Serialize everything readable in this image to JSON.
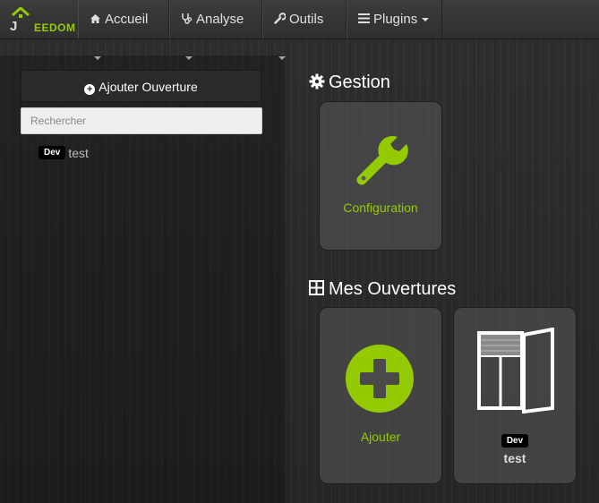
{
  "brand": {
    "letter": "J",
    "text": "EEDOM"
  },
  "nav": [
    {
      "label": "Accueil",
      "icon": "home-icon"
    },
    {
      "label": "Analyse",
      "icon": "stethoscope-icon"
    },
    {
      "label": "Outils",
      "icon": "wrench-icon"
    },
    {
      "label": "Plugins",
      "icon": "list-icon"
    }
  ],
  "sidebar": {
    "add_label": "Ajouter Ouverture",
    "search_placeholder": "Rechercher",
    "items": [
      {
        "badge": "Dev",
        "name": "test"
      }
    ]
  },
  "main": {
    "gestion_title": "Gestion",
    "config_label": "Configuration",
    "ouvertures_title": "Mes Ouvertures",
    "add_label": "Ajouter",
    "equipment": {
      "badge": "Dev",
      "name": "test"
    }
  },
  "colors": {
    "accent": "#94ca02",
    "background": "#2b2b2b"
  }
}
